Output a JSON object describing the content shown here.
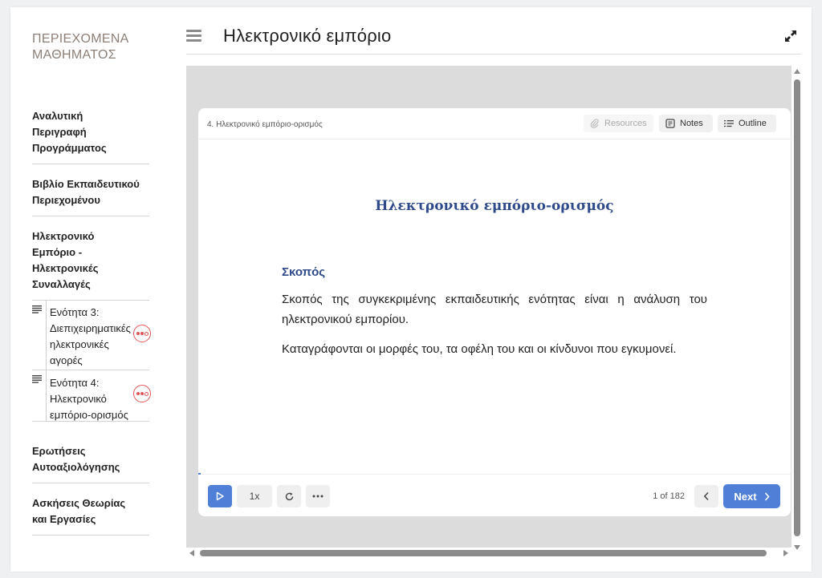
{
  "sidebar": {
    "title": "ΠΕΡΙΕΧΟΜΕΝΑ ΜΑΘΗΜΑΤΟΣ",
    "items": [
      {
        "label": "Αναλυτική Περιγραφή Προγράμματος"
      },
      {
        "label": "Βιβλίο Εκπαιδευτικού Περιεχομένου"
      },
      {
        "label": "Ηλεκτρονικό Εμπόριο - Ηλεκτρονικές Συναλλαγές"
      }
    ],
    "subitems": [
      {
        "label": "Ενότητα 3: Διεπιχειρηματικές ηλεκτρονικές αγορές",
        "icon": "document-lines-icon",
        "status_icon": "progress-dots-icon"
      },
      {
        "label": "Ενότητα 4: Ηλεκτρονικό εμπόριο-ορισμός",
        "icon": "document-lines-icon",
        "status_icon": "progress-dots-icon"
      }
    ],
    "items_after": [
      {
        "label": "Ερωτήσεις Αυτοαξιολόγησης"
      },
      {
        "label": "Ασκήσεις Θεωρίας και Εργασίες"
      }
    ]
  },
  "header": {
    "title": "Ηλεκτρονικό εμπόριο",
    "menu_icon": "hamburger-icon",
    "expand_icon": "expand-icon"
  },
  "player": {
    "slide_label": "4. Ηλεκτρονικό εμπόριο-ορισμός",
    "resources_label": "Resources",
    "notes_label": "Notes",
    "outline_label": "Outline",
    "speed_label": "1x",
    "page_count": "1 of 182",
    "next_label": "Next",
    "accent_color": "#4f7fd6"
  },
  "slide": {
    "title": "Ηλεκτρονικό εμπόριο-ορισμός",
    "heading": "Σκοπός",
    "paragraphs": [
      "Σκοπός της συγκεκριμένης εκπαιδευτικής ενότητας είναι η ανάλυση του ηλεκτρονικού εμπορίου.",
      "Καταγράφονται οι μορφές του, τα οφέλη του και οι κίνδυνοι που εγκυμονεί."
    ],
    "title_color": "#2e4a8a"
  }
}
